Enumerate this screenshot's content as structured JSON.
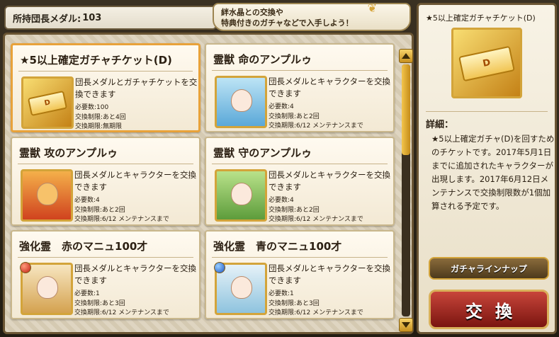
{
  "header": {
    "medal_label": "所持団長メダル:",
    "medal_count": "103",
    "banner_line1": "絆水晶との交換や",
    "banner_line2": "特典付きのガチャなどで入手しよう！"
  },
  "items": [
    {
      "title": "★5以上確定ガチャチケット(D)",
      "desc": "団長メダルとガチャチケットを交換できます",
      "required": "必要数:100",
      "remaining": "交換制限:あと4回",
      "period": "交換期限:無期限",
      "thumb_type": "ticket",
      "ticket_letter": "D"
    },
    {
      "title": "霊獣 命のアンプルゥ",
      "desc": "団長メダルとキャラクターを交換できます",
      "required": "必要数:4",
      "remaining": "交換制限:あと2回",
      "period": "交換期限:6/12 メンテナンスまで",
      "thumb_type": "blue"
    },
    {
      "title": "霊獣 攻のアンプルゥ",
      "desc": "団長メダルとキャラクターを交換できます",
      "required": "必要数:4",
      "remaining": "交換制限:あと2回",
      "period": "交換期限:6/12 メンテナンスまで",
      "thumb_type": "red"
    },
    {
      "title": "霊獣 守のアンプルゥ",
      "desc": "団長メダルとキャラクターを交換できます",
      "required": "必要数:4",
      "remaining": "交換制限:あと2回",
      "period": "交換期限:6/12 メンテナンスまで",
      "thumb_type": "green"
    },
    {
      "title": "強化霊　赤のマニュ100才",
      "desc": "団長メダルとキャラクターを交換できます",
      "required": "必要数:1",
      "remaining": "交換制限:あと3回",
      "period": "交換期限:6/12 メンテナンスまで",
      "thumb_type": "crimson"
    },
    {
      "title": "強化霊　青のマニュ100才",
      "desc": "団長メダルとキャラクターを交換できます",
      "required": "必要数:1",
      "remaining": "交換制限:あと3回",
      "period": "交換期限:6/12 メンテナンスまで",
      "thumb_type": "azure"
    }
  ],
  "scroll_position": 0.0,
  "detail": {
    "name": "★5以上確定ガチャチケット(D)",
    "label": "詳細：",
    "text": "★5以上確定ガチャ(D)を回すためのチケットです。2017年5月1日までに追加されたキャラクターが出現します。2017年6月12日メンテナンスで交換制限数が1個加算される予定です。",
    "ticket_letter": "D",
    "gacha_button": "ガチャラインナップ",
    "exchange_button": "交換"
  },
  "colors": {
    "accent_gold": "#d3a43a",
    "exchange_red": "#c8453a",
    "selected_border": "#e8a23a"
  }
}
